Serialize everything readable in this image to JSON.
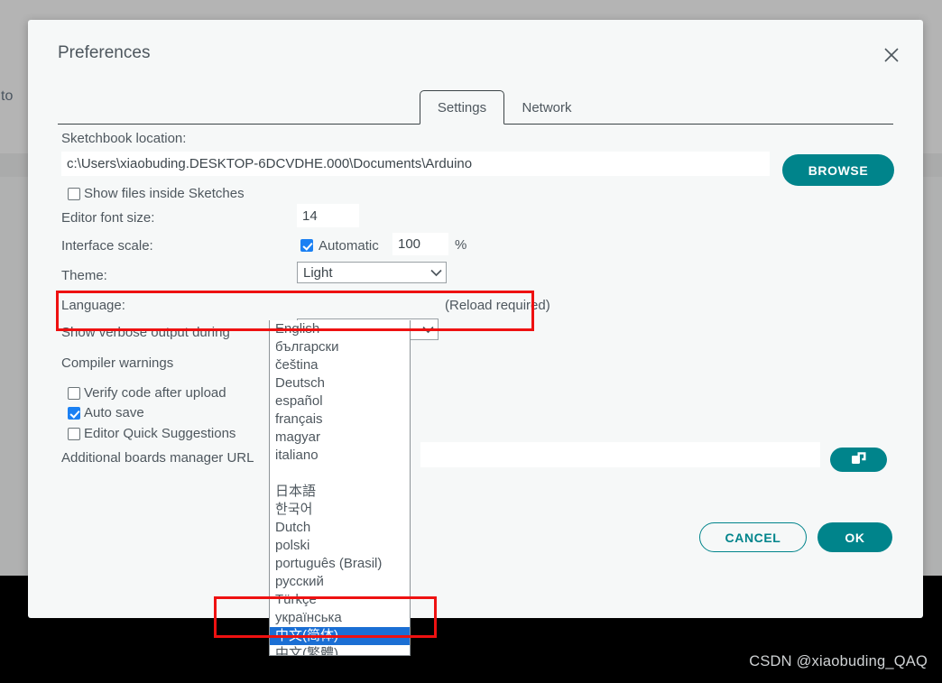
{
  "background": {
    "left_text": "to",
    "watermark": "CSDN @xiaobuding_QAQ"
  },
  "dialog": {
    "title": "Preferences",
    "close_icon": "close-icon",
    "tabs": [
      {
        "label": "Settings",
        "active": true
      },
      {
        "label": "Network",
        "active": false
      }
    ],
    "fields": {
      "sketchbook_label": "Sketchbook location:",
      "sketchbook_value": "c:\\Users\\xiaobuding.DESKTOP-6DCVDHE.000\\Documents\\Arduino",
      "browse_label": "BROWSE",
      "show_files_label": "Show files inside Sketches",
      "show_files_checked": false,
      "font_size_label": "Editor font size:",
      "font_size_value": "14",
      "interface_scale_label": "Interface scale:",
      "automatic_label": "Automatic",
      "automatic_checked": true,
      "scale_value": "100",
      "percent_symbol": "%",
      "theme_label": "Theme:",
      "theme_value": "Light",
      "language_label": "Language:",
      "language_value": "English",
      "reload_note": "(Reload required)",
      "verbose_label": "Show verbose output during",
      "compiler_warnings_label": "Compiler warnings",
      "verify_label": "Verify code after upload",
      "verify_checked": false,
      "autosave_label": "Auto save",
      "autosave_checked": true,
      "quick_suggestions_label": "Editor Quick Suggestions",
      "quick_suggestions_checked": false,
      "boards_url_label": "Additional boards manager URL",
      "boards_url_value": "",
      "boards_url_icon": "open-window-icon"
    },
    "footer": {
      "cancel_label": "CANCEL",
      "ok_label": "OK"
    },
    "language_dropdown": {
      "open": true,
      "selected": "中文(简体)",
      "options": [
        "English",
        "български",
        "čeština",
        "Deutsch",
        "español",
        "français",
        "magyar",
        "italiano",
        "",
        "日本語",
        "한국어",
        "Dutch",
        "polski",
        "português (Brasil)",
        "русский",
        "Türkçe",
        "українська",
        "中文(简体)",
        "中文(繁體)"
      ]
    }
  },
  "annotations": {
    "language_row_highlight_color": "#ee1111",
    "chinese_option_highlight_color": "#ee1111"
  },
  "colors": {
    "accent_teal": "#00848b",
    "selection_blue": "#1b6fd4",
    "checkbox_blue": "#1b80f3",
    "dialog_bg": "#f6f8f8"
  }
}
